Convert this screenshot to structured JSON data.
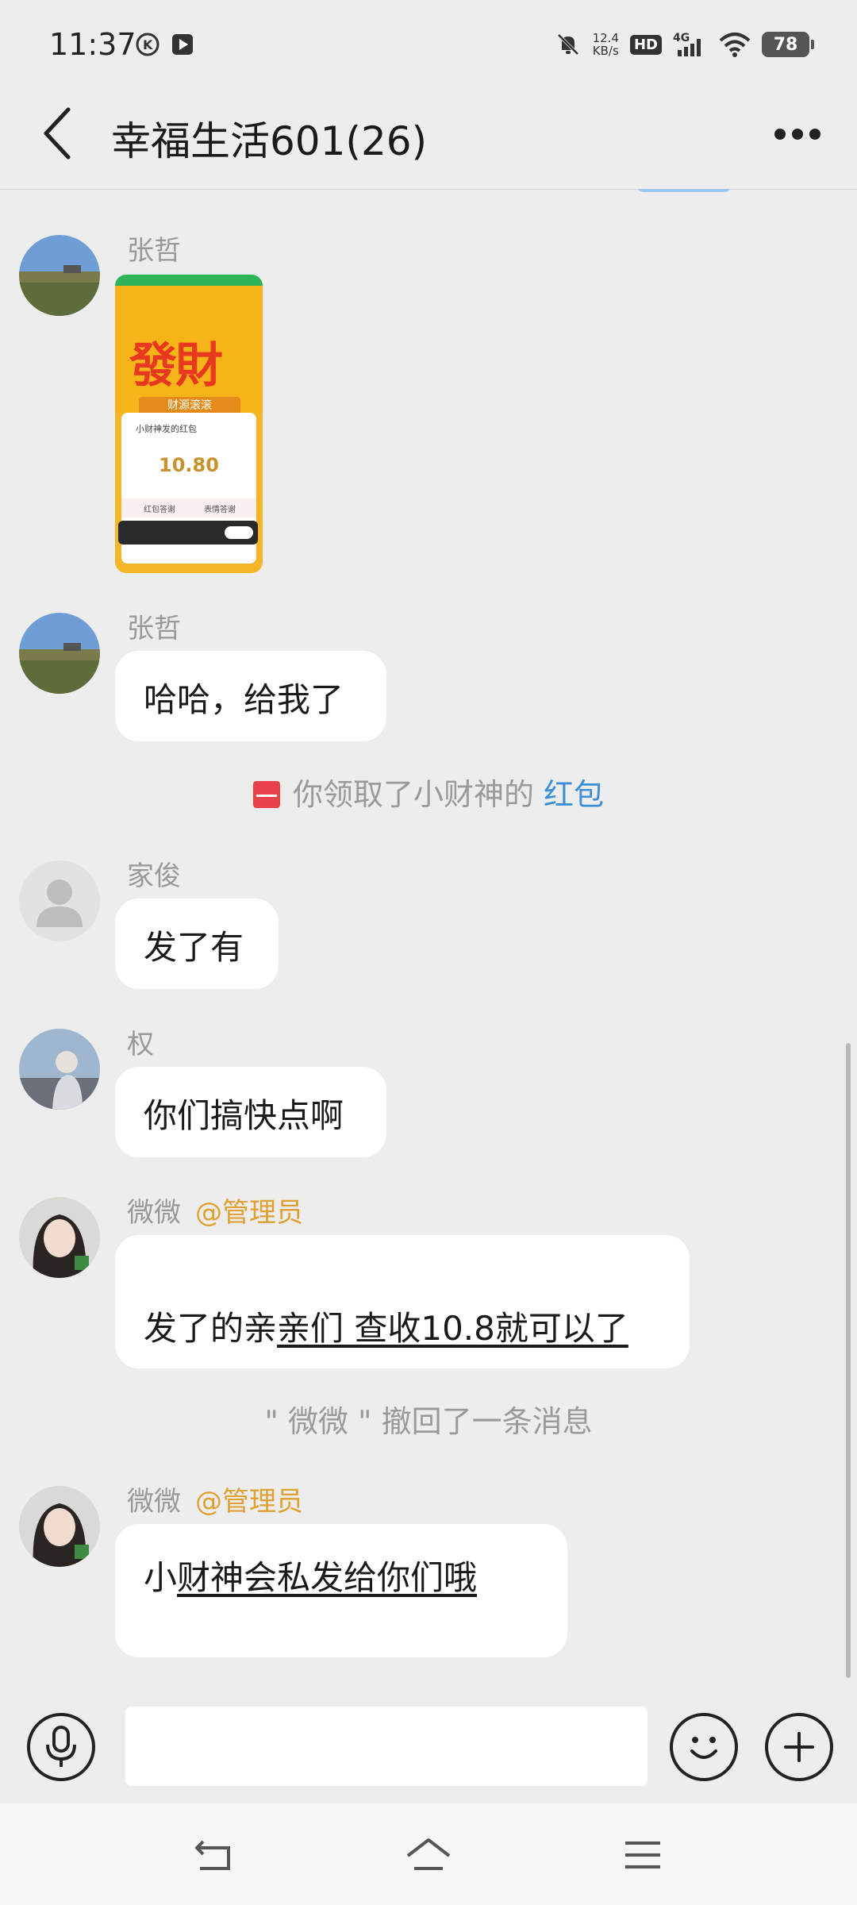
{
  "status": {
    "time": "11:37",
    "speed_value": "12.4",
    "speed_unit": "KB/s",
    "hd": "HD",
    "network": "4G",
    "battery": "78"
  },
  "header": {
    "title": "幸福生活601(26)"
  },
  "card": {
    "big": "發財",
    "banner": "财源滚滚",
    "title": "小财神发的红包",
    "amount": "10.80",
    "tab1": "红包答谢",
    "tab2": "表情答谢"
  },
  "messages": {
    "m1": {
      "sender": "张哲"
    },
    "m2": {
      "sender": "张哲",
      "text": "哈哈，给我了"
    },
    "system1": {
      "text": "你领取了小财神的",
      "link": "红包"
    },
    "m3": {
      "sender": "家俊",
      "text": "发了有"
    },
    "m4": {
      "sender": "权",
      "text": "你们搞快点啊"
    },
    "m5": {
      "sender": "微微",
      "tag": "@管理员",
      "text_a": "发了的亲",
      "text_b": "亲们  查收10.8就可以了"
    },
    "system2": {
      "text": "\" 微微 \" 撤回了一条消息"
    },
    "m6": {
      "sender": "微微",
      "tag": "@管理员",
      "text_a": "小",
      "text_b": "财神会私发给你们哦  "
    }
  },
  "colors": {
    "background": "#ededed",
    "bubble": "#ffffff",
    "admin_tag": "#e0a032",
    "link": "#3a8fd8",
    "red_packet": "#e8434b"
  }
}
